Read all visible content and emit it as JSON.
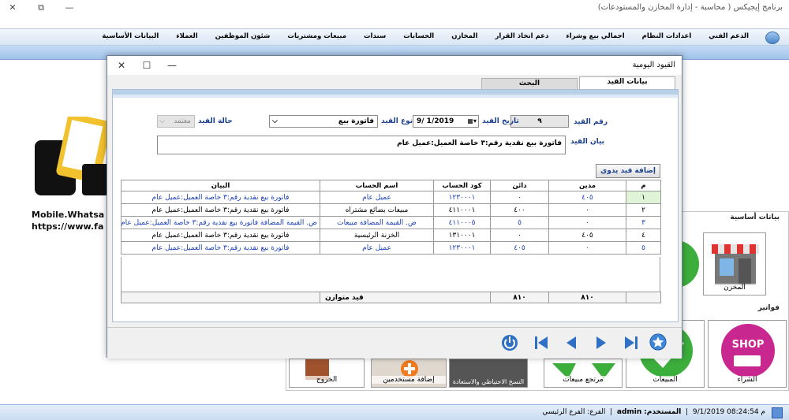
{
  "app": {
    "title": "برنامج إيجيكس ( محاسبة - إدارة المخازن والمستودعات)"
  },
  "menu": {
    "items": [
      "البيانات الأساسية",
      "العملاء",
      "شئون الموظفين",
      "مبيعات ومشتريات",
      "سندات",
      "الحسابات",
      "المخازن",
      "دعم اتخاذ القرار",
      "اجمالي بيع وشراء",
      "اعدادات النظام",
      "الدعم الفني"
    ]
  },
  "background": {
    "logo_text_1": "Mobile.Whatsa",
    "logo_text_2": "https://www.fa",
    "logo_letter": "E",
    "section_basic": "بيانات أساسية",
    "section_invoices": "فواتير",
    "tiles": {
      "store": "المخزن",
      "shop_logo": "SHOP",
      "purchase": "الشراء",
      "sales": "المبيعات",
      "sales_return": "مرتجع مبيعات",
      "backup": "النسخ الاحتياطي والاستعادة",
      "add_user": "إضافة مستخدمين",
      "exit": "الخروج"
    }
  },
  "status": {
    "time_label": "م 08:24:54 9/1/2019",
    "user_label": "المستخدم:",
    "user": "admin",
    "branch_label": "الفرع:",
    "branch": "الفرع الرئيسي"
  },
  "dialog": {
    "title": "القيود اليومية",
    "tabs": {
      "data": "بيانات القيد",
      "search": "البحث"
    },
    "form": {
      "entry_no_label": "رقم القيد",
      "entry_no": "٩",
      "date_label": "تاريخ القيد",
      "date": "9/ 1/2019",
      "type_label": "نوع القيد",
      "type": "فاتورة بيع",
      "status_label": "حالة القيد",
      "status": "معتمد",
      "statement_label": "بيان القيد",
      "statement": "فاتورة بيع نقدية رقم:٣ خاصة العميل:عميل عام"
    },
    "add_button": "إضافة قيد يدوي",
    "grid": {
      "headers": {
        "m": "م",
        "debit": "مدين",
        "credit": "دائن",
        "code": "كود الحساب",
        "name": "اسم الحساب",
        "desc": "البيان"
      },
      "rows": [
        {
          "m": "١",
          "debit": "٤٠٥",
          "credit": "٠",
          "code": "١٢٣٠٠٠١",
          "name": "عميل عام",
          "desc": "فاتورة بيع نقدية رقم:٣ خاصة العميل:عميل عام"
        },
        {
          "m": "٢",
          "debit": "٠",
          "credit": "٤٠٠",
          "code": "٤١١٠٠٠١",
          "name": "مبيعات بضائع مشتراه",
          "desc": "فاتورة بيع نقدية رقم:٣ خاصة العميل:عميل عام"
        },
        {
          "m": "٣",
          "debit": "٠",
          "credit": "٥",
          "code": "٤١١٠٠٠٥",
          "name": "ض. القيمة المضافة مبيعات",
          "desc": "ض. القيمة المضافة فاتورة بيع نقدية رقم:٣ خاصة العميل:عميل عام"
        },
        {
          "m": "٤",
          "debit": "٤٠٥",
          "credit": "٠",
          "code": "١٣١٠٠٠١",
          "name": "الخزنة الرئيسية",
          "desc": "فاتورة بيع نقدية رقم:٣ خاصة العميل:عميل عام"
        },
        {
          "m": "٥",
          "debit": "٠",
          "credit": "٤٠٥",
          "code": "١٢٣٠٠٠١",
          "name": "عميل عام",
          "desc": "فاتورة بيع نقدية رقم:٣ خاصة العميل:عميل عام"
        }
      ]
    },
    "totals": {
      "debit": "٨١٠",
      "credit": "٨١٠",
      "balance_label": "قيد متوازن"
    }
  }
}
